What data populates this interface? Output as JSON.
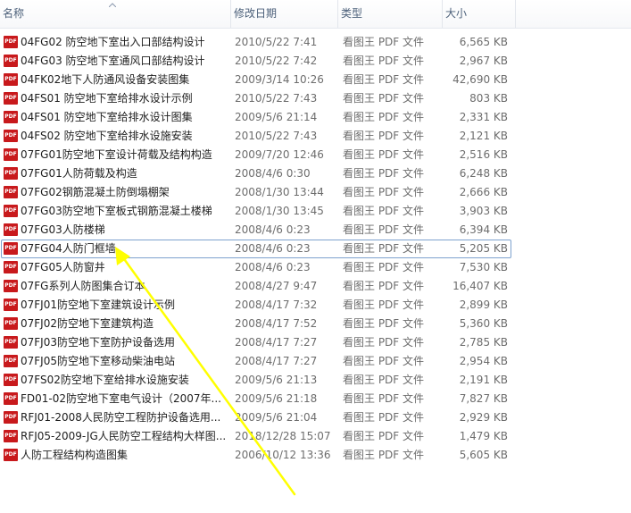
{
  "columns": {
    "name": "名称",
    "modified": "修改日期",
    "type": "类型",
    "size": "大小"
  },
  "icons": {
    "file_icon": "pdf-file-icon",
    "file_icon_text": "PDF",
    "sort": "sort-up-arrow-icon"
  },
  "colors": {
    "pdf_red": "#c8191c",
    "focus_border": "#7da2ce",
    "annotation_arrow": "#ffff00"
  },
  "files": [
    {
      "name": "04FG02 防空地下室出入口部结构设计",
      "modified": "2010/5/22 7:41",
      "type": "看图王 PDF 文件",
      "size": "6,565 KB"
    },
    {
      "name": "04FG03 防空地下室通风口部结构设计",
      "modified": "2010/5/22 7:42",
      "type": "看图王 PDF 文件",
      "size": "2,967 KB"
    },
    {
      "name": "04FK02地下人防通风设备安装图集",
      "modified": "2009/3/14 10:26",
      "type": "看图王 PDF 文件",
      "size": "42,690 KB"
    },
    {
      "name": "04FS01 防空地下室给排水设计示例",
      "modified": "2010/5/22 7:43",
      "type": "看图王 PDF 文件",
      "size": "803 KB"
    },
    {
      "name": "04FS01 防空地下室给排水设计图集",
      "modified": "2009/5/6 21:14",
      "type": "看图王 PDF 文件",
      "size": "2,331 KB"
    },
    {
      "name": "04FS02 防空地下室给排水设施安装",
      "modified": "2010/5/22 7:43",
      "type": "看图王 PDF 文件",
      "size": "2,121 KB"
    },
    {
      "name": "07FG01防空地下室设计荷载及结构构造",
      "modified": "2009/7/20 12:46",
      "type": "看图王 PDF 文件",
      "size": "2,516 KB"
    },
    {
      "name": "07FG01人防荷载及构造",
      "modified": "2008/4/6 0:30",
      "type": "看图王 PDF 文件",
      "size": "6,248 KB"
    },
    {
      "name": "07FG02钢筋混凝土防倒塌棚架",
      "modified": "2008/1/30 13:44",
      "type": "看图王 PDF 文件",
      "size": "2,666 KB"
    },
    {
      "name": "07FG03防空地下室板式钢筋混凝土楼梯",
      "modified": "2008/1/30 13:45",
      "type": "看图王 PDF 文件",
      "size": "3,903 KB"
    },
    {
      "name": "07FG03人防楼梯",
      "modified": "2008/4/6 0:23",
      "type": "看图王 PDF 文件",
      "size": "6,394 KB"
    },
    {
      "name": "07FG04人防门框墙",
      "modified": "2008/4/6 0:23",
      "type": "看图王 PDF 文件",
      "size": "5,205 KB",
      "focused": true
    },
    {
      "name": "07FG05人防窗井",
      "modified": "2008/4/6 0:23",
      "type": "看图王 PDF 文件",
      "size": "7,530 KB"
    },
    {
      "name": "07FG系列人防图集合订本",
      "modified": "2008/4/27 9:47",
      "type": "看图王 PDF 文件",
      "size": "16,407 KB"
    },
    {
      "name": "07FJ01防空地下室建筑设计示例",
      "modified": "2008/4/17 7:32",
      "type": "看图王 PDF 文件",
      "size": "2,899 KB"
    },
    {
      "name": "07FJ02防空地下室建筑构造",
      "modified": "2008/4/17 7:52",
      "type": "看图王 PDF 文件",
      "size": "5,360 KB"
    },
    {
      "name": "07FJ03防空地下室防护设备选用",
      "modified": "2008/4/17 7:27",
      "type": "看图王 PDF 文件",
      "size": "2,785 KB"
    },
    {
      "name": "07FJ05防空地下室移动柴油电站",
      "modified": "2008/4/17 7:27",
      "type": "看图王 PDF 文件",
      "size": "2,954 KB"
    },
    {
      "name": "07FS02防空地下室给排水设施安装",
      "modified": "2009/5/6 21:13",
      "type": "看图王 PDF 文件",
      "size": "2,191 KB"
    },
    {
      "name": "FD01-02防空地下室电气设计（2007年...",
      "modified": "2009/5/6 21:18",
      "type": "看图王 PDF 文件",
      "size": "7,827 KB"
    },
    {
      "name": "RFJ01-2008人民防空工程防护设备选用...",
      "modified": "2009/5/6 21:04",
      "type": "看图王 PDF 文件",
      "size": "2,929 KB"
    },
    {
      "name": "RFJ05-2009-JG人民防空工程结构大样图...",
      "modified": "2018/12/28 15:07",
      "type": "看图王 PDF 文件",
      "size": "1,479 KB"
    },
    {
      "name": "人防工程结构构造图集",
      "modified": "2006/10/12 13:36",
      "type": "看图王 PDF 文件",
      "size": "5,605 KB"
    }
  ]
}
